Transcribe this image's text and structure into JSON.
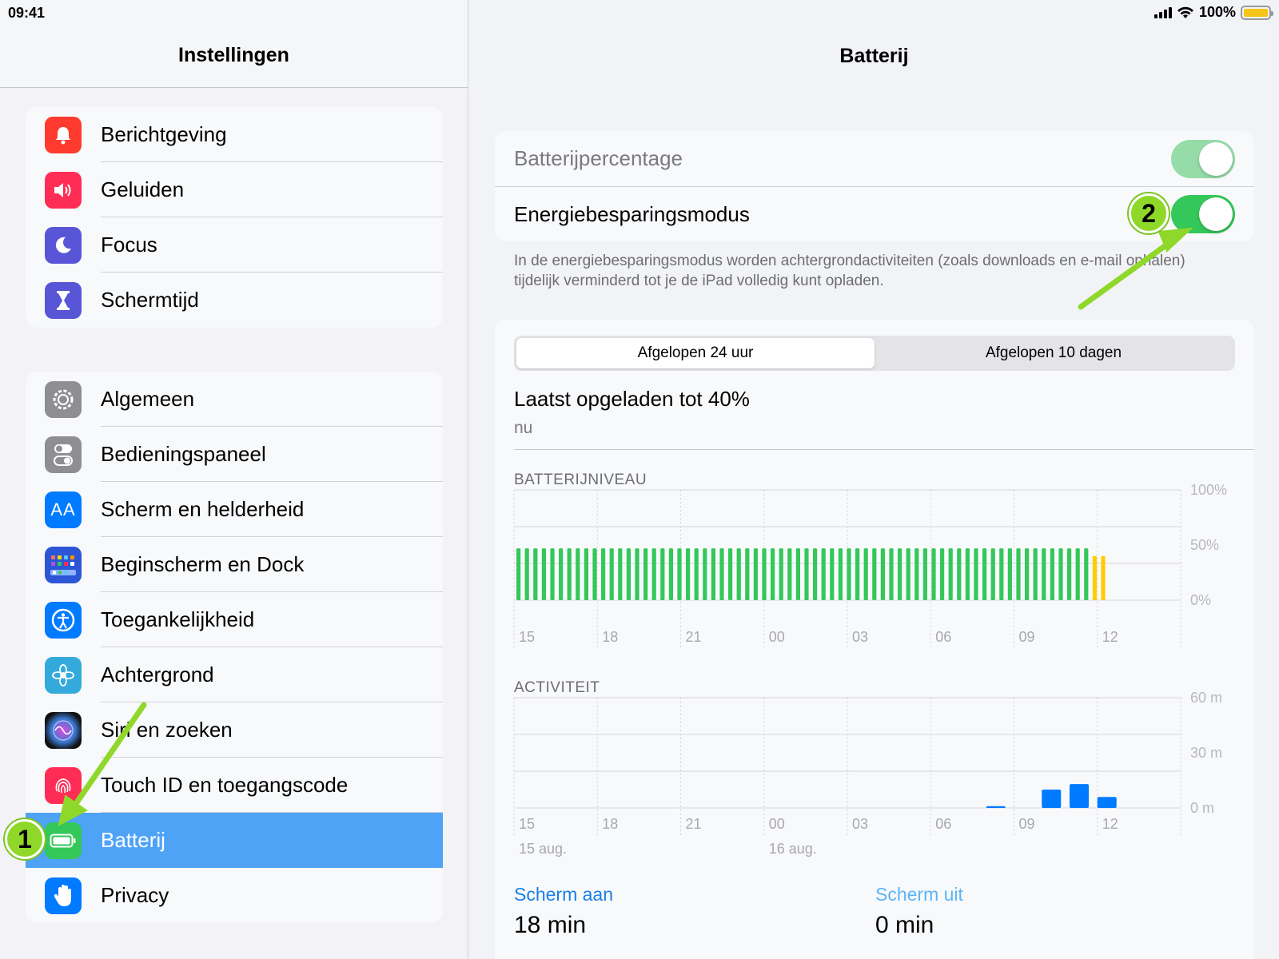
{
  "status": {
    "time": "09:41",
    "battery": "100%"
  },
  "left": {
    "title": "Instellingen",
    "group1": [
      {
        "label": "Berichtgeving",
        "icon": "bell-icon",
        "color": "#ff3b30"
      },
      {
        "label": "Geluiden",
        "icon": "speaker-icon",
        "color": "#ff2d55"
      },
      {
        "label": "Focus",
        "icon": "moon-icon",
        "color": "#5856d6"
      },
      {
        "label": "Schermtijd",
        "icon": "hourglass-icon",
        "color": "#5856d6"
      }
    ],
    "group2": [
      {
        "label": "Algemeen",
        "icon": "gear-icon",
        "color": "#8e8e93"
      },
      {
        "label": "Bedieningspaneel",
        "icon": "toggles-icon",
        "color": "#8e8e93"
      },
      {
        "label": "Scherm en helderheid",
        "icon": "text-size-icon",
        "color": "#007aff"
      },
      {
        "label": "Beginscherm en Dock",
        "icon": "home-grid-icon",
        "color": "#2c56d6"
      },
      {
        "label": "Toegankelijkheid",
        "icon": "accessibility-icon",
        "color": "#007aff"
      },
      {
        "label": "Achtergrond",
        "icon": "flower-icon",
        "color": "#34aadc"
      },
      {
        "label": "Siri en zoeken",
        "icon": "siri-icon",
        "color": "#222222"
      },
      {
        "label": "Touch ID en toegangscode",
        "icon": "fingerprint-icon",
        "color": "#ff2d55"
      },
      {
        "label": "Batterij",
        "icon": "battery-icon",
        "color": "#34c759",
        "selected": true
      },
      {
        "label": "Privacy",
        "icon": "hand-icon",
        "color": "#007aff"
      }
    ]
  },
  "right": {
    "title": "Batterij",
    "battery_percentage_label": "Batterijpercentage",
    "battery_percentage_on": true,
    "low_power_label": "Energiebesparingsmodus",
    "low_power_on": true,
    "footnote": "In de energiebesparingsmodus worden achtergrondactiviteiten (zoals downloads en e-mail ophalen) tijdelijk verminderd tot je de iPad volledig kunt opladen.",
    "segments": [
      "Afgelopen 24 uur",
      "Afgelopen 10 dagen"
    ],
    "active_segment": 0,
    "last_charged": "Laatst opgeladen tot 40%",
    "last_charged_time": "nu",
    "battery_level_label": "BATTERIJNIVEAU",
    "activity_label": "ACTIVITEIT",
    "screen_on_label": "Scherm aan",
    "screen_on_value": "18 min",
    "screen_off_label": "Scherm uit",
    "screen_off_value": "0 min"
  },
  "annotations": {
    "badge1": "1",
    "badge2": "2"
  },
  "chart_data": [
    {
      "type": "bar",
      "title": "BATTERIJNIVEAU",
      "x_ticks": [
        "15",
        "18",
        "21",
        "00",
        "03",
        "06",
        "09",
        "12"
      ],
      "y_ticks": [
        "100%",
        "50%",
        "0%"
      ],
      "ylim": [
        0,
        100
      ],
      "bar_count": 70,
      "green_value": 47,
      "yellow_value": 40,
      "yellow_from_index": 68,
      "colors": {
        "normal": "#34c759",
        "low_power": "#ffcc00"
      }
    },
    {
      "type": "bar",
      "title": "ACTIVITEIT",
      "x_ticks": [
        "15",
        "18",
        "21",
        "00",
        "03",
        "06",
        "09",
        "12"
      ],
      "date_labels": [
        "15 aug.",
        "16 aug."
      ],
      "y_ticks": [
        "60 m",
        "30 m",
        "0 m"
      ],
      "ylim": [
        0,
        60
      ],
      "bars": [
        {
          "hour_offset": 17.0,
          "value": 1
        },
        {
          "hour_offset": 19.0,
          "value": 10
        },
        {
          "hour_offset": 20.0,
          "value": 13
        },
        {
          "hour_offset": 21.0,
          "value": 6
        }
      ],
      "color": "#007aff"
    }
  ]
}
